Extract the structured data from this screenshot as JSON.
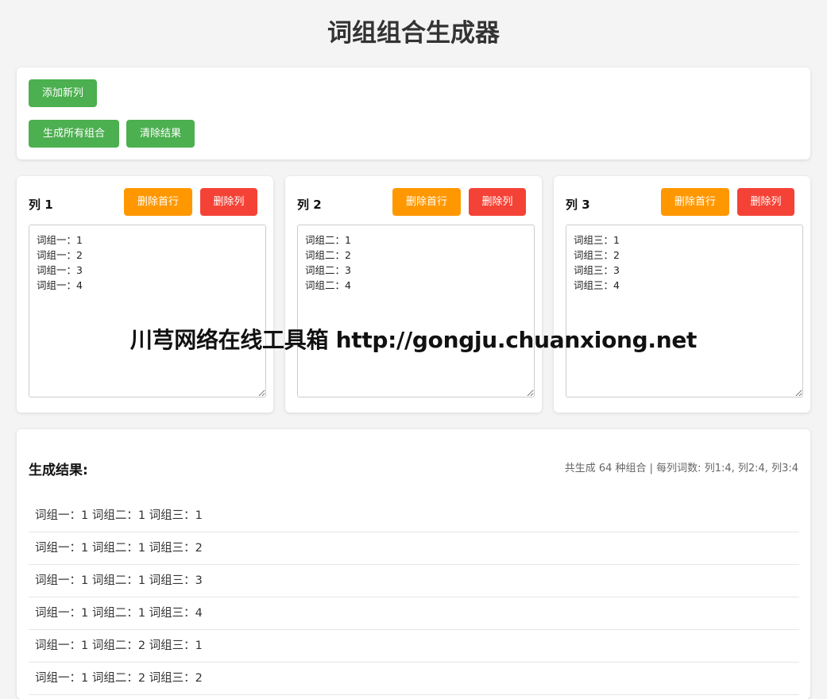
{
  "header": {
    "title": "词组组合生成器"
  },
  "controls": {
    "add_column_label": "添加新列",
    "generate_label": "生成所有组合",
    "clear_label": "清除结果"
  },
  "columns": [
    {
      "title": "列 1",
      "remove_first_label": "删除首行",
      "delete_label": "删除列",
      "text": "词组一：1\n词组一：2\n词组一：3\n词组一：4"
    },
    {
      "title": "列 2",
      "remove_first_label": "删除首行",
      "delete_label": "删除列",
      "text": "词组二：1\n词组二：2\n词组二：3\n词组二：4"
    },
    {
      "title": "列 3",
      "remove_first_label": "删除首行",
      "delete_label": "删除列",
      "text": "词组三：1\n词组三：2\n词组三：3\n词组三：4"
    }
  ],
  "watermark": "川芎网络在线工具箱 http://gongju.chuanxiong.net",
  "results": {
    "title": "生成结果:",
    "summary": "共生成 64 种组合 | 每列词数: 列1:4, 列2:4, 列3:4",
    "items": [
      "词组一：1 词组二：1 词组三：1",
      "词组一：1 词组二：1 词组三：2",
      "词组一：1 词组二：1 词组三：3",
      "词组一：1 词组二：1 词组三：4",
      "词组一：1 词组二：2 词组三：1",
      "词组一：1 词组二：2 词组三：2"
    ]
  },
  "colors": {
    "green": "#4caf50",
    "orange": "#ff9800",
    "red": "#f44336",
    "background": "#f4f4f4"
  }
}
